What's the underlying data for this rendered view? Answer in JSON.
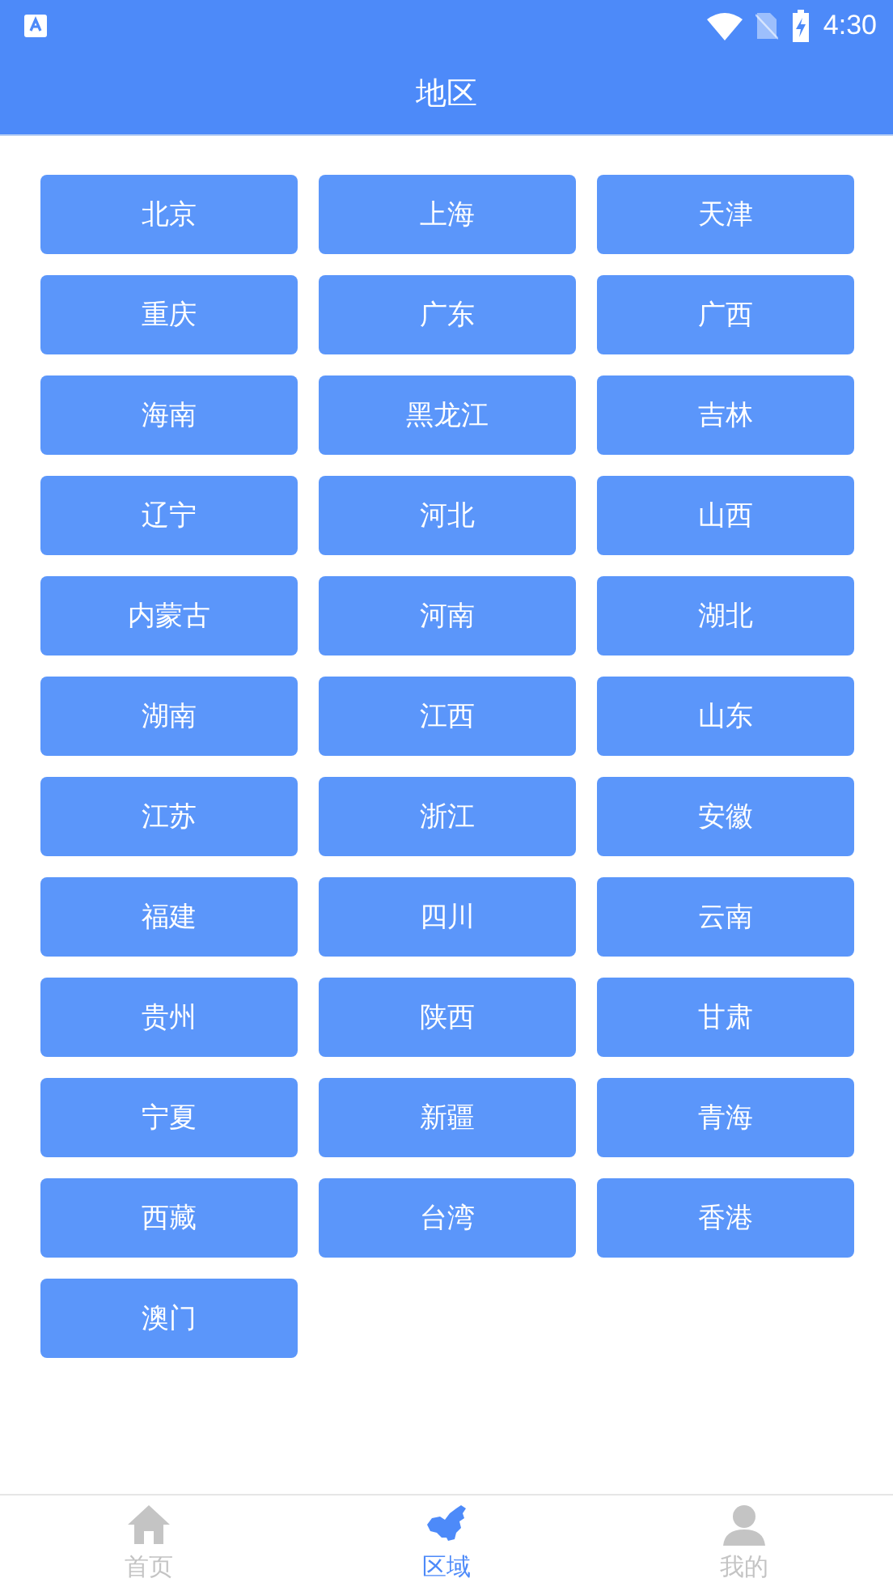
{
  "status_bar": {
    "time": "4:30"
  },
  "header": {
    "title": "地区"
  },
  "regions": [
    "北京",
    "上海",
    "天津",
    "重庆",
    "广东",
    "广西",
    "海南",
    "黑龙江",
    "吉林",
    "辽宁",
    "河北",
    "山西",
    "内蒙古",
    "河南",
    "湖北",
    "湖南",
    "江西",
    "山东",
    "江苏",
    "浙江",
    "安徽",
    "福建",
    "四川",
    "云南",
    "贵州",
    "陕西",
    "甘肃",
    "宁夏",
    "新疆",
    "青海",
    "西藏",
    "台湾",
    "香港",
    "澳门"
  ],
  "tabs": [
    {
      "label": "首页",
      "selected": false
    },
    {
      "label": "区域",
      "selected": true
    },
    {
      "label": "我的",
      "selected": false
    }
  ]
}
